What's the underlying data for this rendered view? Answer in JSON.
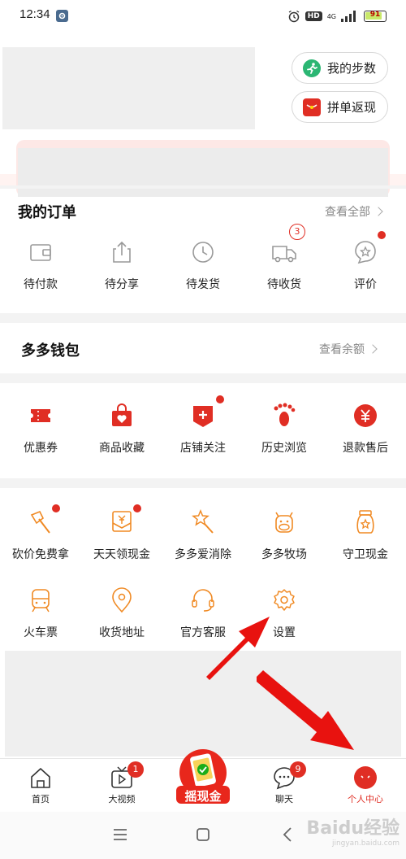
{
  "status_bar": {
    "time": "12:34",
    "network": "4G",
    "hd": "HD",
    "battery": "91"
  },
  "header": {
    "steps_label": "我的步数",
    "group_refund_label": "拼单返现"
  },
  "orders": {
    "title": "我的订单",
    "view_all": "查看全部",
    "items": [
      {
        "label": "待付款",
        "icon": "wallet-icon"
      },
      {
        "label": "待分享",
        "icon": "share-icon"
      },
      {
        "label": "待发货",
        "icon": "clock-icon"
      },
      {
        "label": "待收货",
        "icon": "truck-icon",
        "badge": "3"
      },
      {
        "label": "评价",
        "icon": "review-icon",
        "dot": true
      }
    ]
  },
  "wallet": {
    "title": "多多钱包",
    "view_balance": "查看余额"
  },
  "shortcuts": [
    {
      "label": "优惠券",
      "icon": "coupon-icon"
    },
    {
      "label": "商品收藏",
      "icon": "favorite-bag-icon"
    },
    {
      "label": "店铺关注",
      "icon": "store-follow-icon",
      "dot": true
    },
    {
      "label": "历史浏览",
      "icon": "footprint-icon"
    },
    {
      "label": "退款售后",
      "icon": "refund-icon"
    }
  ],
  "services": [
    {
      "label": "砍价免费拿",
      "icon": "axe-icon",
      "dot": true
    },
    {
      "label": "天天领现金",
      "icon": "cash-envelope-icon",
      "dot": true
    },
    {
      "label": "多多爱消除",
      "icon": "star-wand-icon"
    },
    {
      "label": "多多牧场",
      "icon": "cow-icon"
    },
    {
      "label": "守卫现金",
      "icon": "money-jar-icon"
    },
    {
      "label": "火车票",
      "icon": "train-icon"
    },
    {
      "label": "收货地址",
      "icon": "location-icon"
    },
    {
      "label": "官方客服",
      "icon": "headset-icon"
    },
    {
      "label": "设置",
      "icon": "settings-gear-icon"
    }
  ],
  "tabbar": {
    "items": [
      {
        "label": "首页",
        "icon": "home-icon"
      },
      {
        "label": "大视频",
        "icon": "video-icon",
        "badge": "1"
      },
      {
        "label": "摇现金",
        "icon": "shake-cash-icon"
      },
      {
        "label": "聊天",
        "icon": "chat-icon",
        "badge": "9"
      },
      {
        "label": "个人中心",
        "icon": "profile-icon"
      }
    ]
  },
  "watermark": {
    "text": "Baidu经验",
    "sub": "jingyan.baidu.com"
  },
  "colors": {
    "accent": "#e02e24",
    "orange": "#f08a24",
    "gray_icon": "#999999"
  }
}
